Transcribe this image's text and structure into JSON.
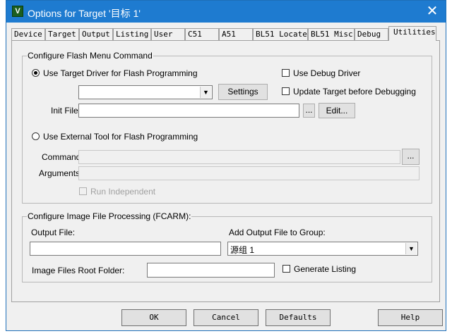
{
  "window": {
    "title": "Options for Target '目标 1'",
    "close_glyph": "✕"
  },
  "tabs": [
    {
      "label": "Device"
    },
    {
      "label": "Target"
    },
    {
      "label": "Output"
    },
    {
      "label": "Listing"
    },
    {
      "label": "User"
    },
    {
      "label": "C51"
    },
    {
      "label": "A51"
    },
    {
      "label": "BL51 Locate"
    },
    {
      "label": "BL51 Misc"
    },
    {
      "label": "Debug"
    },
    {
      "label": "Utilities"
    }
  ],
  "active_tab": "Utilities",
  "flash": {
    "group_label": "Configure Flash Menu Command",
    "use_target_driver_label": "Use Target Driver for Flash Programming",
    "use_target_driver_selected": true,
    "driver_select_value": "",
    "settings_label": "Settings",
    "use_debug_driver_label": "Use Debug Driver",
    "use_debug_driver_checked": false,
    "update_target_label": "Update Target before Debugging",
    "update_target_checked": false,
    "init_file_label": "Init File:",
    "init_file_value": "",
    "browse_label": "...",
    "edit_label": "Edit...",
    "use_external_label": "Use External Tool for Flash Programming",
    "use_external_selected": false,
    "command_label": "Command:",
    "command_value": "",
    "command_browse_label": "...",
    "arguments_label": "Arguments:",
    "arguments_value": "",
    "run_independent_label": "Run Independent",
    "run_independent_checked": false
  },
  "image": {
    "group_label": "Configure Image File Processing (FCARM):",
    "output_file_label": "Output File:",
    "output_file_value": "",
    "add_output_label": "Add Output File  to Group:",
    "group_select_value": "源组 1",
    "root_folder_label": "Image Files Root Folder:",
    "root_folder_value": "",
    "generate_listing_label": "Generate Listing",
    "generate_listing_checked": false
  },
  "footer": {
    "ok_label": "OK",
    "cancel_label": "Cancel",
    "defaults_label": "Defaults",
    "help_label": "Help"
  },
  "dropdown_glyph": "▼",
  "colors": {
    "titlebar": "#1e7bd0",
    "window_bg": "#f0f0f0"
  }
}
